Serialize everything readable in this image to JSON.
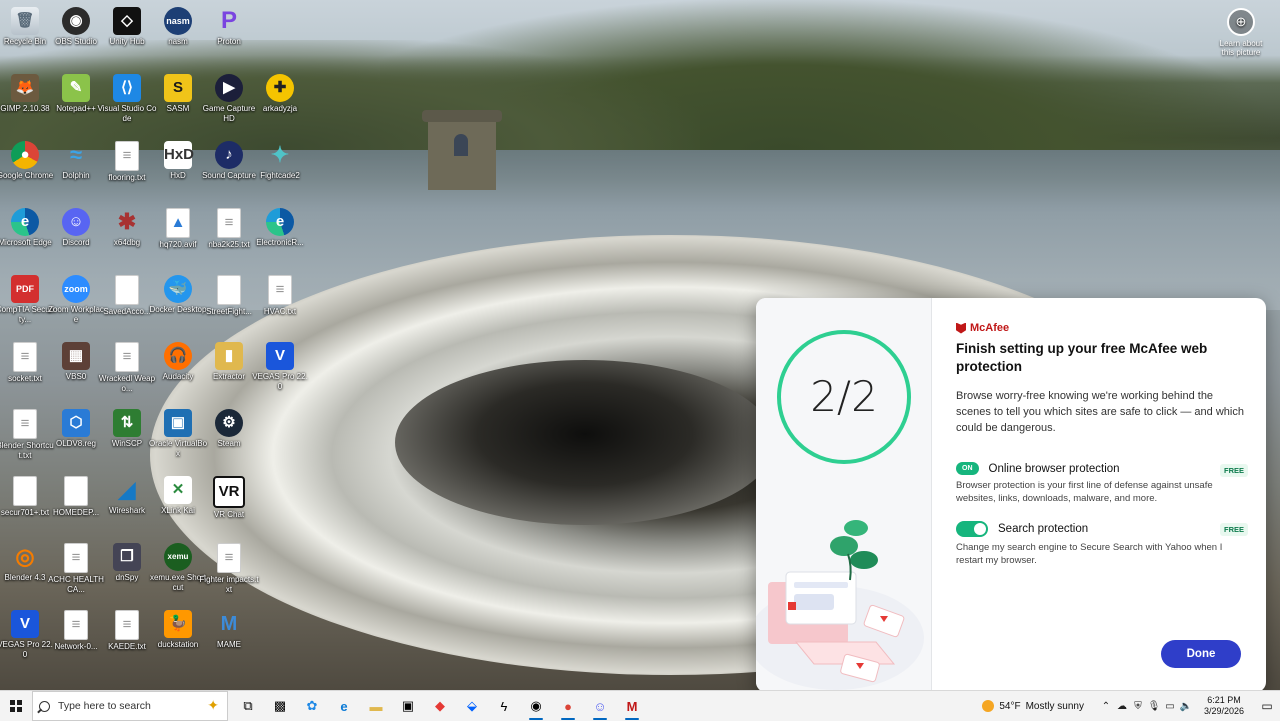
{
  "desktop": {
    "icons": [
      {
        "label": "Recycle Bin",
        "icon": "recycle-bin-icon",
        "glyph": "🗑"
      },
      {
        "label": "OBS Studio",
        "icon": "obs-icon",
        "glyph": "◉"
      },
      {
        "label": "Unity Hub",
        "icon": "unity-icon",
        "glyph": "◇"
      },
      {
        "label": "nasm",
        "icon": "nasm-icon",
        "glyph": "nasm"
      },
      {
        "label": "Proton",
        "icon": "proton-icon",
        "glyph": "P"
      },
      {
        "label": "GIMP 2.10.38",
        "icon": "gimp-icon",
        "glyph": "🦊"
      },
      {
        "label": "Notepad++",
        "icon": "notepadpp-icon",
        "glyph": "✎"
      },
      {
        "label": "Visual Studio Code",
        "icon": "vscode-icon",
        "glyph": "⟨⟩"
      },
      {
        "label": "SASM",
        "icon": "sasm-icon",
        "glyph": "S"
      },
      {
        "label": "Game Capture HD",
        "icon": "game-capture-icon",
        "glyph": "▶"
      },
      {
        "label": "arkadyzja",
        "icon": "arkadyzja-icon",
        "glyph": "✚"
      },
      {
        "label": "Google Chrome",
        "icon": "chrome-icon",
        "glyph": "●"
      },
      {
        "label": "Dolphin",
        "icon": "dolphin-icon",
        "glyph": "≈"
      },
      {
        "label": "flooring.txt",
        "icon": "text-file-icon",
        "glyph": "≡"
      },
      {
        "label": "HxD",
        "icon": "hxd-icon",
        "glyph": "HxD"
      },
      {
        "label": "Sound Capture",
        "icon": "sound-capture-icon",
        "glyph": "♪"
      },
      {
        "label": "Fightcade2",
        "icon": "fightcade-icon",
        "glyph": "✦"
      },
      {
        "label": "Microsoft Edge",
        "icon": "edge-icon",
        "glyph": "e"
      },
      {
        "label": "Discord",
        "icon": "discord-icon",
        "glyph": "☺"
      },
      {
        "label": "x64dbg",
        "icon": "x64dbg-icon",
        "glyph": "✱"
      },
      {
        "label": "hq720.avif",
        "icon": "image-file-icon",
        "glyph": "▲"
      },
      {
        "label": "nba2k25.txt",
        "icon": "text-file-icon",
        "glyph": "≡"
      },
      {
        "label": "ElectronicR...",
        "icon": "edge-icon",
        "glyph": "e"
      },
      {
        "label": "CompTIA Security...",
        "icon": "pdf-icon",
        "glyph": "PDF"
      },
      {
        "label": "Zoom Workplace",
        "icon": "zoom-icon",
        "glyph": "zoom"
      },
      {
        "label": "SavedAcco...",
        "icon": "blank-file-icon",
        "glyph": ""
      },
      {
        "label": "Docker Desktop",
        "icon": "docker-icon",
        "glyph": "🐳"
      },
      {
        "label": "StreetFight...",
        "icon": "blank-file-icon",
        "glyph": ""
      },
      {
        "label": "HVAC.txt",
        "icon": "text-file-icon",
        "glyph": "≡"
      },
      {
        "label": "socket.txt",
        "icon": "text-file-icon",
        "glyph": "≡"
      },
      {
        "label": "VBS0",
        "icon": "vbs-icon",
        "glyph": "▦"
      },
      {
        "label": "Wrackedl Weapo...",
        "icon": "text-file-icon",
        "glyph": "≡"
      },
      {
        "label": "Audacity",
        "icon": "audacity-icon",
        "glyph": "🎧"
      },
      {
        "label": "Extractor",
        "icon": "folder-icon",
        "glyph": "▮"
      },
      {
        "label": "VEGAS Pro 22.0",
        "icon": "vegas-icon",
        "glyph": "V"
      },
      {
        "label": "Blender Shortcut.txt",
        "icon": "text-file-icon",
        "glyph": "≡"
      },
      {
        "label": "OLDV8.reg",
        "icon": "registry-icon",
        "glyph": "⬡"
      },
      {
        "label": "WinSCP",
        "icon": "winscp-icon",
        "glyph": "⇅"
      },
      {
        "label": "Oracle VirtualBox",
        "icon": "virtualbox-icon",
        "glyph": "▣"
      },
      {
        "label": "Steam",
        "icon": "steam-icon",
        "glyph": "⚙"
      },
      {
        "label": "secur701+.txt",
        "icon": "blank-file-icon",
        "glyph": ""
      },
      {
        "label": "HOMEDEP...",
        "icon": "blank-file-icon",
        "glyph": ""
      },
      {
        "label": "Wireshark",
        "icon": "wireshark-icon",
        "glyph": "◢"
      },
      {
        "label": "XLink Kai",
        "icon": "xlink-kai-icon",
        "glyph": "✕"
      },
      {
        "label": "VR Chat",
        "icon": "vrchat-icon",
        "glyph": "VR"
      },
      {
        "label": "Blender 4.3",
        "icon": "blender-icon",
        "glyph": "◎"
      },
      {
        "label": "ACHC HEALTHCA...",
        "icon": "text-file-icon",
        "glyph": "≡"
      },
      {
        "label": "dnSpy",
        "icon": "dnspy-icon",
        "glyph": "❐"
      },
      {
        "label": "xemu.exe Shortcut",
        "icon": "xemu-icon",
        "glyph": "xemu"
      },
      {
        "label": "Fighter impacts.txt",
        "icon": "text-file-icon",
        "glyph": "≡"
      },
      {
        "label": "VEGAS Pro 22.0",
        "icon": "vegas-icon",
        "glyph": "V"
      },
      {
        "label": "Network-0...",
        "icon": "text-file-icon",
        "glyph": "≡"
      },
      {
        "label": "KAEDE.txt",
        "icon": "text-file-icon",
        "glyph": "≡"
      },
      {
        "label": "duckstation",
        "icon": "duckstation-icon",
        "glyph": "🦆"
      },
      {
        "label": "MAME",
        "icon": "mame-icon",
        "glyph": "M"
      }
    ],
    "learn": {
      "label": "Learn about this picture",
      "glyph": "⊕"
    }
  },
  "mcafee": {
    "progress_text": "2/2",
    "progress_fraction": 1.0,
    "brand": "McAfee",
    "title": "Finish setting up your free McAfee web protection",
    "description": "Browse worry-free knowing we're working behind the scenes to tell you which sites are safe to click — and which could be dangerous.",
    "options": [
      {
        "state_label": "ON",
        "title": "Online browser protection",
        "badge": "FREE",
        "desc": "Browser protection is your first line of defense against unsafe websites, links, downloads, malware, and more."
      },
      {
        "state_label": "",
        "title": "Search protection",
        "badge": "FREE",
        "desc": "Change my search engine to Secure Search with Yahoo when I restart my browser."
      }
    ],
    "done_label": "Done",
    "accent": "#16b57d",
    "button_color": "#2f3ec9",
    "brand_color": "#c01818"
  },
  "taskbar": {
    "search_placeholder": "Type here to search",
    "apps": [
      {
        "name": "task-view-icon",
        "glyph": "⧉"
      },
      {
        "name": "widgets-icon",
        "glyph": "▩"
      },
      {
        "name": "copilot-icon",
        "glyph": "✿"
      },
      {
        "name": "edge-icon",
        "glyph": "e"
      },
      {
        "name": "file-explorer-icon",
        "glyph": "▬"
      },
      {
        "name": "store-icon",
        "glyph": "▣"
      },
      {
        "name": "red-diamond-app-icon",
        "glyph": "◆"
      },
      {
        "name": "dropbox-icon",
        "glyph": "⬙"
      },
      {
        "name": "lightning-app-icon",
        "glyph": "ϟ"
      },
      {
        "name": "recorder-icon",
        "glyph": "◉"
      },
      {
        "name": "chrome-icon",
        "glyph": "●"
      },
      {
        "name": "discord-icon",
        "glyph": "☺"
      },
      {
        "name": "mcafee-icon",
        "glyph": "M"
      }
    ],
    "weather_temp": "54°F",
    "weather_text": "Mostly sunny",
    "time": "6:21 PM",
    "date": "3/29/2026"
  }
}
